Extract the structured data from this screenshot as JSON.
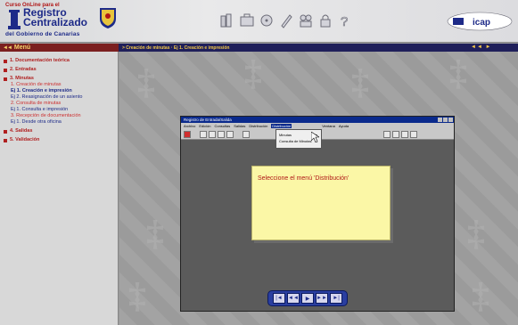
{
  "header": {
    "logo_small": "Curso OnLine para el",
    "logo_line1": "Registro",
    "logo_line2": "Centralizado",
    "logo_org": "del Gobierno de Canarias",
    "toolbar_icons": [
      "books-icon",
      "briefcase-icon",
      "disk-icon",
      "pencil-icon",
      "people-icon",
      "lock-icon",
      "help-icon"
    ],
    "brand_logo": "ibm-icap-logo"
  },
  "nav": {
    "menu_label": "Menú",
    "breadcrumb": "> Creación de minutas · Ej 1. Creación e impresión",
    "pager": "◄◄ ►"
  },
  "sidebar": {
    "items": [
      {
        "label": "1. Documentación teórica",
        "level": "top"
      },
      {
        "label": "2. Entradas",
        "level": "top"
      },
      {
        "label": "3. Minutas",
        "level": "top"
      },
      {
        "label": "1. Creación de minutas",
        "level": "sub"
      },
      {
        "label": "Ej 1. Creación e impresión",
        "level": "sub-active"
      },
      {
        "label": "Ej 2. Reasignación de un asiento",
        "level": "sub-dark"
      },
      {
        "label": "2. Consulta de minutas",
        "level": "sub"
      },
      {
        "label": "Ej 1. Consulta e impresión",
        "level": "sub-dark"
      },
      {
        "label": "3. Recepción de documentación",
        "level": "sub"
      },
      {
        "label": "Ej 1. Desde otra oficina",
        "level": "sub-dark"
      },
      {
        "label": "4. Salidas",
        "level": "top"
      },
      {
        "label": "5. Validación",
        "level": "top"
      }
    ]
  },
  "app": {
    "title": "Registro de Entrada/Salida",
    "menus": [
      "Archivo",
      "Edición",
      "Consultas",
      "Salidas",
      "Distribución",
      "Distribución",
      "Ventana",
      "Ayuda"
    ],
    "active_menu_index": 5,
    "dropdown": [
      {
        "label": "Minutas",
        "arrow": "►"
      },
      {
        "label": "Consulta de Minutas",
        "arrow": ""
      }
    ],
    "note": "Seleccione el menú 'Distribución'",
    "player_buttons": [
      "|◄",
      "◄◄",
      "▶",
      "►►",
      "►|"
    ]
  },
  "colors": {
    "brand_red": "#7b1f1f",
    "breadcrumb_bg": "#1f1f5a",
    "accent_yellow": "#f3c84a",
    "note_bg": "#fbf7a6",
    "title_blue": "#1d2a88"
  }
}
